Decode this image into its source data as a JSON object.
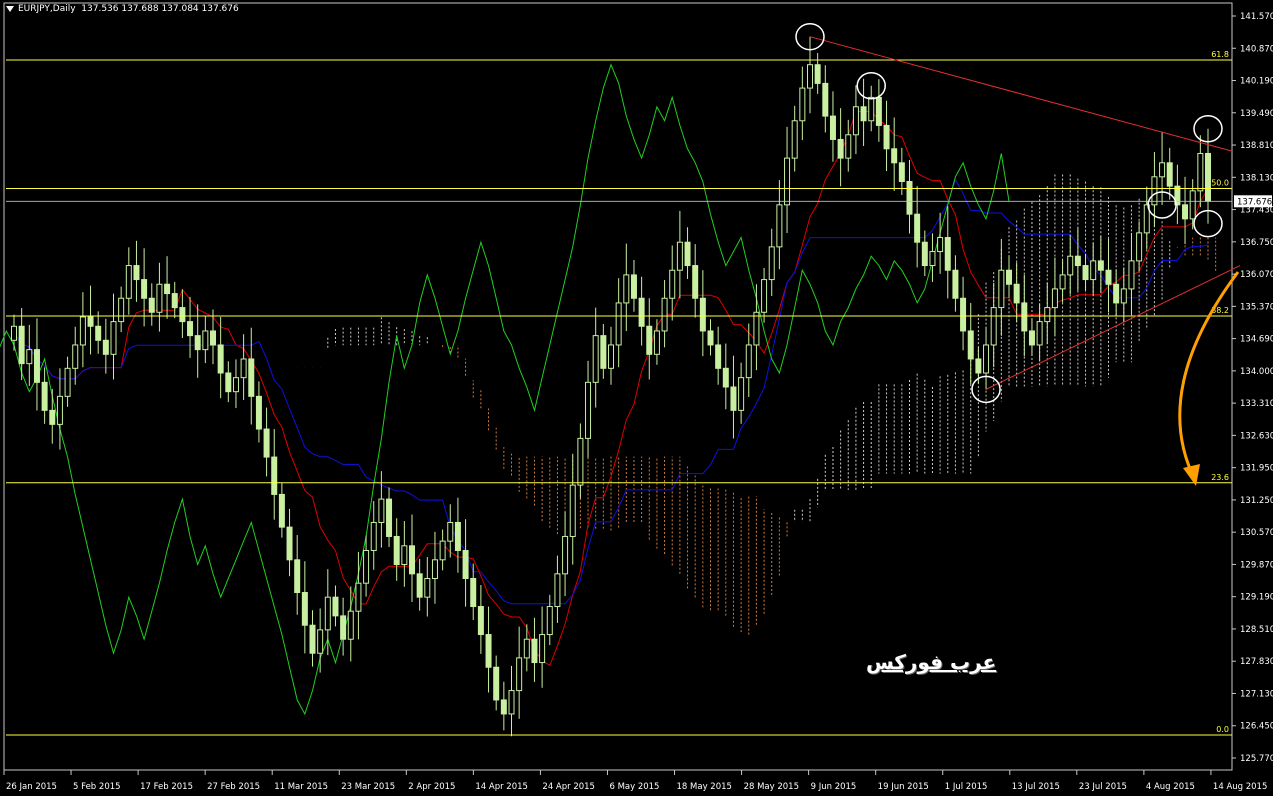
{
  "header": {
    "symbol": "EURJPY,Daily",
    "ohlc": "137.536 137.688 137.084 137.676"
  },
  "watermark": "عرب فوركس",
  "colors": {
    "background": "#000000",
    "frame": "#c8c8c8",
    "candle": "#c8f0a0",
    "candle_up_fill": "#000000",
    "candle_down_fill": "#c8f0a0",
    "tenkan": "#e00000",
    "kijun": "#1010e0",
    "chikou": "#20d020",
    "kumo_bull": "#ffffff",
    "kumo_bear": "#ff9a50",
    "fibo": "#ffff40",
    "trend": "#e03030",
    "arrow": "#ffa000",
    "circle": "#ffffff",
    "current_price": "#c0c0c0"
  },
  "chart_data": {
    "type": "candlestick",
    "title": "EURJPY,Daily",
    "ylim": [
      125.5,
      141.9
    ],
    "y_ticks": [
      "141.570",
      "140.870",
      "140.190",
      "139.490",
      "138.810",
      "138.130",
      "137.430",
      "136.750",
      "136.070",
      "135.370",
      "134.690",
      "134.000",
      "133.310",
      "132.630",
      "131.950",
      "131.250",
      "130.570",
      "129.870",
      "129.190",
      "128.510",
      "127.830",
      "127.130",
      "126.450",
      "125.770"
    ],
    "x_ticks": [
      "26 Jan 2015",
      "5 Feb 2015",
      "17 Feb 2015",
      "27 Feb 2015",
      "11 Mar 2015",
      "23 Mar 2015",
      "2 Apr 2015",
      "14 Apr 2015",
      "24 Apr 2015",
      "6 May 2015",
      "18 May 2015",
      "28 May 2015",
      "9 Jun 2015",
      "19 Jun 2015",
      "1 Jul 2015",
      "13 Jul 2015",
      "23 Jul 2015",
      "4 Aug 2015",
      "14 Aug 2015"
    ],
    "current_price": "137.676",
    "fibonacci": [
      {
        "label": "0.0",
        "value": 126.25
      },
      {
        "label": "23.6",
        "value": 131.65
      },
      {
        "label": "38.2",
        "value": 135.22
      },
      {
        "label": "50.0",
        "value": 137.95
      },
      {
        "label": "61.8",
        "value": 140.7
      }
    ],
    "closes": [
      135.0,
      134.2,
      134.5,
      133.8,
      133.2,
      132.9,
      133.5,
      134.1,
      134.6,
      135.2,
      135.0,
      134.7,
      134.4,
      135.1,
      135.6,
      136.3,
      136.0,
      135.6,
      135.3,
      135.9,
      135.7,
      135.4,
      135.1,
      134.8,
      134.5,
      134.9,
      134.6,
      134.0,
      133.6,
      133.9,
      134.3,
      133.5,
      132.8,
      132.2,
      131.4,
      130.7,
      130.0,
      129.3,
      128.6,
      128.0,
      128.5,
      129.2,
      128.8,
      128.3,
      128.9,
      129.5,
      130.2,
      130.8,
      131.3,
      130.5,
      129.9,
      130.3,
      129.7,
      129.2,
      129.6,
      130.0,
      130.4,
      130.8,
      130.2,
      129.6,
      129.0,
      128.4,
      127.7,
      127.0,
      126.7,
      127.2,
      127.9,
      128.3,
      127.8,
      128.4,
      129.0,
      129.7,
      130.5,
      131.6,
      132.6,
      133.8,
      134.8,
      134.1,
      134.6,
      135.5,
      136.1,
      135.6,
      135.0,
      134.4,
      134.9,
      135.6,
      136.2,
      136.8,
      136.3,
      135.6,
      134.9,
      134.6,
      134.1,
      133.7,
      133.2,
      133.9,
      134.6,
      135.3,
      136.0,
      136.7,
      137.6,
      138.6,
      139.4,
      140.1,
      140.6,
      140.2,
      139.5,
      139.0,
      138.6,
      139.1,
      139.7,
      139.4,
      139.9,
      139.3,
      138.8,
      138.5,
      138.1,
      137.4,
      136.8,
      136.3,
      136.6,
      136.9,
      136.2,
      135.6,
      134.9,
      134.3,
      134.0,
      134.6,
      135.4,
      136.2,
      135.9,
      135.5,
      134.9,
      134.6,
      135.1,
      135.4,
      135.8,
      136.1,
      136.5,
      136.3,
      136.0,
      136.4,
      136.2,
      135.9,
      135.5,
      135.8,
      136.4,
      137.0,
      137.6,
      138.2,
      138.5,
      138.0,
      137.6,
      137.3,
      137.9,
      138.7,
      137.676
    ]
  }
}
